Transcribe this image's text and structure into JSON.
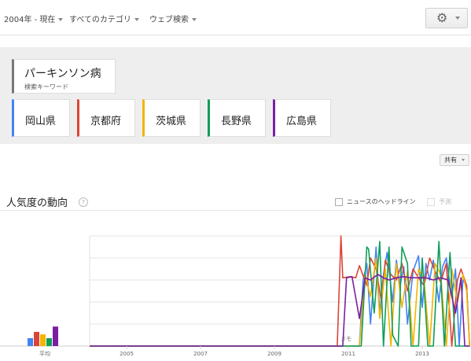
{
  "filters": {
    "time": "2004年 - 現在",
    "category": "すべてのカテゴリ",
    "search_type": "ウェブ検索"
  },
  "settings_icon": "gear-icon",
  "search_term": {
    "text": "パーキンソン病",
    "type_label": "検索キーワード"
  },
  "regions": [
    {
      "name": "岡山県",
      "color": "#4285f4"
    },
    {
      "name": "京都府",
      "color": "#db4437"
    },
    {
      "name": "茨城県",
      "color": "#f4b400"
    },
    {
      "name": "長野県",
      "color": "#0f9d58"
    },
    {
      "name": "広島県",
      "color": "#7b1fa2"
    }
  ],
  "share_label": "共有",
  "section": {
    "title": "人気度の動向",
    "help_icon": "?",
    "news_headlines_label": "ニュースのヘッドライン",
    "forecast_label": "予測"
  },
  "chart_data": {
    "type": "line",
    "x_tick_labels": [
      "2005",
      "2007",
      "2009",
      "2011",
      "2013"
    ],
    "average_label": "平均",
    "annotation": "メモ",
    "ylim": [
      0,
      100
    ],
    "average": [
      {
        "name": "岡山県",
        "value": 25
      },
      {
        "name": "京都府",
        "value": 45
      },
      {
        "name": "茨城県",
        "value": 37
      },
      {
        "name": "長野県",
        "value": 25
      },
      {
        "name": "広島県",
        "value": 62
      }
    ],
    "series": [
      {
        "name": "岡山県",
        "x": [
          2004.0,
          2010.9,
          2011.0,
          2011.1,
          2011.3,
          2011.4,
          2011.5,
          2011.6,
          2011.75,
          2011.85,
          2011.95,
          2012.05,
          2012.2,
          2012.3,
          2012.4,
          2012.5,
          2012.6,
          2012.75,
          2012.9,
          2013.0,
          2013.1,
          2013.2,
          2013.3,
          2013.45,
          2013.55,
          2013.65,
          2013.8,
          2013.9,
          2014.0,
          2014.1,
          2014.2,
          2014.28
        ],
        "values": [
          0,
          0,
          0,
          0,
          0,
          60,
          75,
          20,
          90,
          30,
          65,
          85,
          40,
          78,
          55,
          72,
          20,
          68,
          82,
          35,
          75,
          60,
          78,
          40,
          72,
          80,
          45,
          70,
          0,
          60,
          55,
          0
        ]
      },
      {
        "name": "京都府",
        "x": [
          2004.0,
          2010.7,
          2010.8,
          2010.85,
          2011.05,
          2011.2,
          2011.3,
          2011.5,
          2011.6,
          2011.75,
          2011.9,
          2012.0,
          2012.15,
          2012.3,
          2012.45,
          2012.6,
          2012.75,
          2012.9,
          2013.05,
          2013.2,
          2013.35,
          2013.5,
          2013.65,
          2013.8,
          2013.95,
          2014.05,
          2014.2,
          2014.28
        ],
        "values": [
          0,
          0,
          100,
          62,
          63,
          62,
          73,
          55,
          80,
          70,
          40,
          78,
          65,
          60,
          75,
          50,
          70,
          62,
          55,
          80,
          68,
          58,
          75,
          0,
          60,
          70,
          55,
          0
        ]
      },
      {
        "name": "茨城県",
        "x": [
          2004.0,
          2011.2,
          2011.3,
          2011.45,
          2011.6,
          2011.75,
          2011.85,
          2012.0,
          2012.15,
          2012.3,
          2012.45,
          2012.6,
          2012.75,
          2012.9,
          2013.05,
          2013.2,
          2013.35,
          2013.5,
          2013.65,
          2013.8,
          2013.95,
          2014.1,
          2014.2,
          2014.28
        ],
        "values": [
          0,
          0,
          0,
          65,
          45,
          80,
          25,
          70,
          0,
          75,
          35,
          68,
          0,
          70,
          60,
          0,
          75,
          65,
          0,
          70,
          40,
          65,
          50,
          0
        ]
      },
      {
        "name": "長野県",
        "x": [
          2004.0,
          2011.25,
          2011.35,
          2011.5,
          2011.55,
          2011.7,
          2011.85,
          2011.95,
          2012.1,
          2012.2,
          2012.35,
          2012.45,
          2012.6,
          2012.7,
          2012.9,
          2013.0,
          2013.15,
          2013.3,
          2013.45,
          2013.6,
          2013.75,
          2013.9,
          2014.05,
          2014.2,
          2014.28
        ],
        "values": [
          0,
          0,
          0,
          90,
          88,
          30,
          95,
          0,
          90,
          10,
          0,
          90,
          75,
          0,
          0,
          80,
          0,
          0,
          95,
          0,
          85,
          0,
          0,
          0,
          0
        ]
      },
      {
        "name": "広島県",
        "x": [
          2004.0,
          2010.85,
          2010.95,
          2011.1,
          2011.3,
          2011.45,
          2011.6,
          2011.8,
          2011.95,
          2012.1,
          2012.3,
          2012.5,
          2012.7,
          2012.9,
          2013.1,
          2013.3,
          2013.5,
          2013.7,
          2013.9,
          2014.05,
          2014.15,
          2014.28
        ],
        "values": [
          0,
          0,
          62,
          63,
          25,
          62,
          60,
          65,
          62,
          60,
          62,
          63,
          62,
          62,
          62,
          60,
          62,
          60,
          30,
          62,
          0,
          0
        ]
      }
    ]
  }
}
